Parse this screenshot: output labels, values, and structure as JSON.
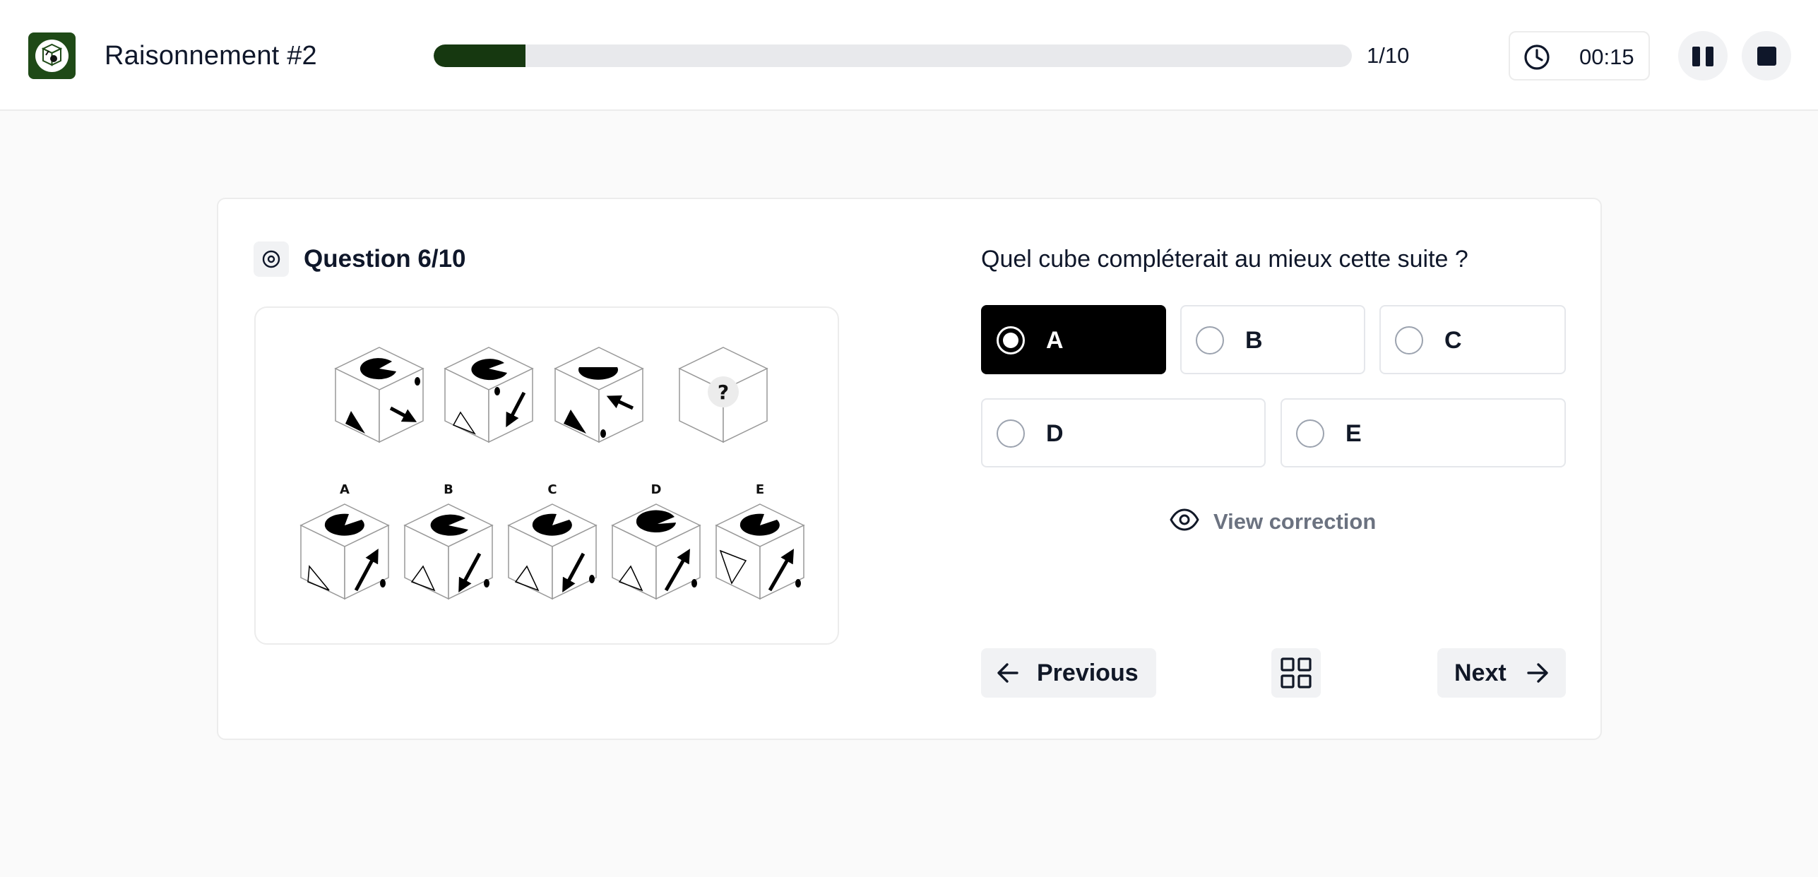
{
  "header": {
    "title": "Raisonnement #2",
    "progress_fraction": 0.1,
    "progress_label": "1/10",
    "timer": "00:15",
    "colors": {
      "brand": "#1f4a17",
      "progress_fill": "#163810"
    }
  },
  "question": {
    "title": "Question 6/10",
    "prompt": "Quel cube compléterait au mieux cette suite ?",
    "figure": {
      "sequence_mark": "?",
      "option_letters": [
        "A",
        "B",
        "C",
        "D",
        "E"
      ]
    },
    "options": [
      {
        "label": "A",
        "selected": true
      },
      {
        "label": "B",
        "selected": false
      },
      {
        "label": "C",
        "selected": false
      },
      {
        "label": "D",
        "selected": false
      },
      {
        "label": "E",
        "selected": false
      }
    ],
    "view_correction_label": "View correction"
  },
  "navigation": {
    "previous_label": "Previous",
    "next_label": "Next",
    "grid_icon": "grid-icon"
  }
}
